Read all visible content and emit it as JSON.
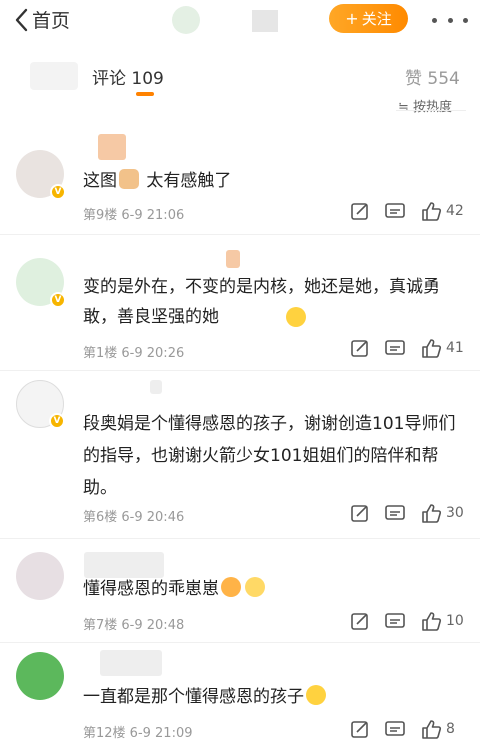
{
  "nav": {
    "back_label": "首页",
    "follow_label": "关注"
  },
  "tabs": {
    "comment_label": "评论 109",
    "like_label": "赞 554"
  },
  "sort_label": "≒ 按热度",
  "comments": [
    {
      "text": "这图",
      "text2": "太有感触了",
      "meta": "第9楼 6-9 21:06",
      "likes": "42"
    },
    {
      "text": "变的是外在，不变的是内核，她还是她，真诚勇敢，善良坚强的她",
      "meta": "第1楼 6-9 20:26",
      "likes": "41"
    },
    {
      "text": "段奥娟是个懂得感恩的孩子，谢谢创造101导师们的指导，也谢谢火箭少女101姐姐们的陪伴和帮助。",
      "meta": "第6楼 6-9 20:46",
      "likes": "30"
    },
    {
      "text": "懂得感恩的乖崽崽",
      "meta": "第7楼 6-9 20:48",
      "likes": "10"
    },
    {
      "text": "一直都是那个懂得感恩的孩子",
      "meta": "第12楼 6-9 21:09",
      "likes": "8"
    }
  ],
  "icons": [
    "chevron-left-icon",
    "more-icon",
    "share-icon",
    "comment-icon",
    "like-icon",
    "v-badge-icon"
  ],
  "colors": {
    "accent": "#ff8200",
    "verified": "#f7b500"
  }
}
